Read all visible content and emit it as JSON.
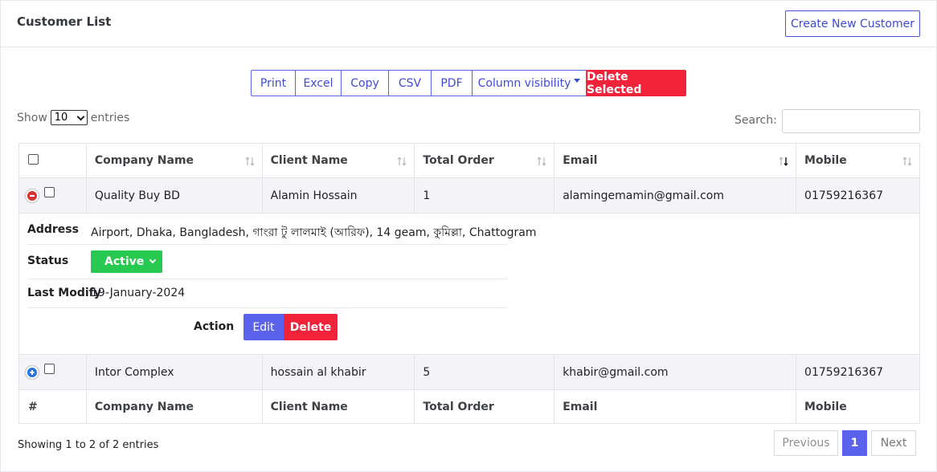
{
  "header": {
    "title": "Customer List",
    "create_button": "Create New Customer"
  },
  "toolbar": {
    "buttons": [
      "Print",
      "Excel",
      "Copy",
      "CSV",
      "PDF",
      "Column visibility"
    ],
    "delete_selected": "Delete Selected"
  },
  "length": {
    "show_label": "Show",
    "value": "10",
    "entries_label": "entries"
  },
  "search": {
    "label": "Search:",
    "value": "",
    "placeholder": ""
  },
  "table": {
    "columns": [
      "Company Name",
      "Client Name",
      "Total Order",
      "Email",
      "Mobile"
    ],
    "footer_index": "#",
    "rows": [
      {
        "company": "Quality Buy BD",
        "client": "Alamin Hossain",
        "orders": "1",
        "email": "alamingemamin@gmail.com",
        "mobile": "01759216367",
        "expanded": true
      },
      {
        "company": "Intor Complex",
        "client": "hossain al khabir",
        "orders": "5",
        "email": "khabir@gmail.com",
        "mobile": "01759216367",
        "expanded": false
      }
    ],
    "detail": {
      "address_label": "Address",
      "address_value": "Airport, Dhaka, Bangladesh, গাংরা টু লালমাই (আরিফ), 14 geam, কুমিল্লা, Chattogram",
      "status_label": "Status",
      "status_value": "Active",
      "last_modify_label": "Last Modify",
      "last_modify_value": "19-January-2024",
      "action_label": "Action",
      "edit_label": "Edit",
      "delete_label": "Delete"
    }
  },
  "footer": {
    "info": "Showing 1 to 2 of 2 entries",
    "previous": "Previous",
    "current_page": "1",
    "next": "Next"
  },
  "colors": {
    "primary": "#5b62ec",
    "danger": "#f0233b",
    "success": "#28c950",
    "expand_icon": "#2274e0",
    "collapse_icon": "#d33333"
  }
}
